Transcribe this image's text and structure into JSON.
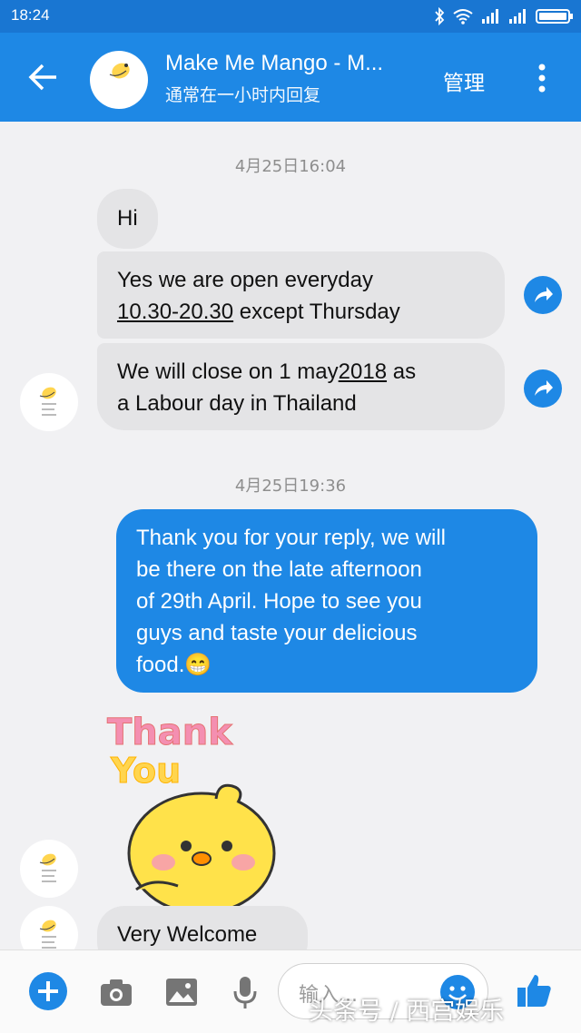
{
  "status_bar": {
    "time": "18:24"
  },
  "header": {
    "title": "Make Me Mango - M...",
    "subtitle": "通常在一小时内回复",
    "manage_label": "管理",
    "avatar_text": "make me mango"
  },
  "messages": {
    "timestamp_1": "4月25日16:04",
    "msg_hi": "Hi",
    "msg_open_line1": "Yes we are open everyday",
    "msg_open_hours": "10.30-20.30",
    "msg_open_rest": " except Thursday",
    "msg_close_pre": "We will close on 1 may",
    "msg_close_year": "2018",
    "msg_close_post": " as",
    "msg_close_line2": "a Labour day in Thailand",
    "timestamp_2": "4月25日19:36",
    "msg_reply_line1": "Thank you for your reply, we will",
    "msg_reply_line2": "be there on the late afternoon",
    "msg_reply_line3": "of 29th April. Hope to see you",
    "msg_reply_line4": "guys and taste your delicious",
    "msg_reply_line5": "food.",
    "msg_reply_emoji": "😁",
    "sticker_text_1": "Thank",
    "sticker_text_2": "You",
    "msg_welcome": "Very Welcome"
  },
  "composer": {
    "placeholder": "输入...",
    "watermark": "头条号 / 西宫娱乐"
  },
  "colors": {
    "brand_blue": "#1e88e5",
    "status_blue": "#1976d2",
    "received_bubble": "#e4e4e6"
  },
  "icons": [
    "back-arrow-icon",
    "more-vert-icon",
    "share-icon",
    "plus-icon",
    "camera-icon",
    "gallery-icon",
    "mic-icon",
    "emoji-icon",
    "thumbs-up-icon"
  ]
}
